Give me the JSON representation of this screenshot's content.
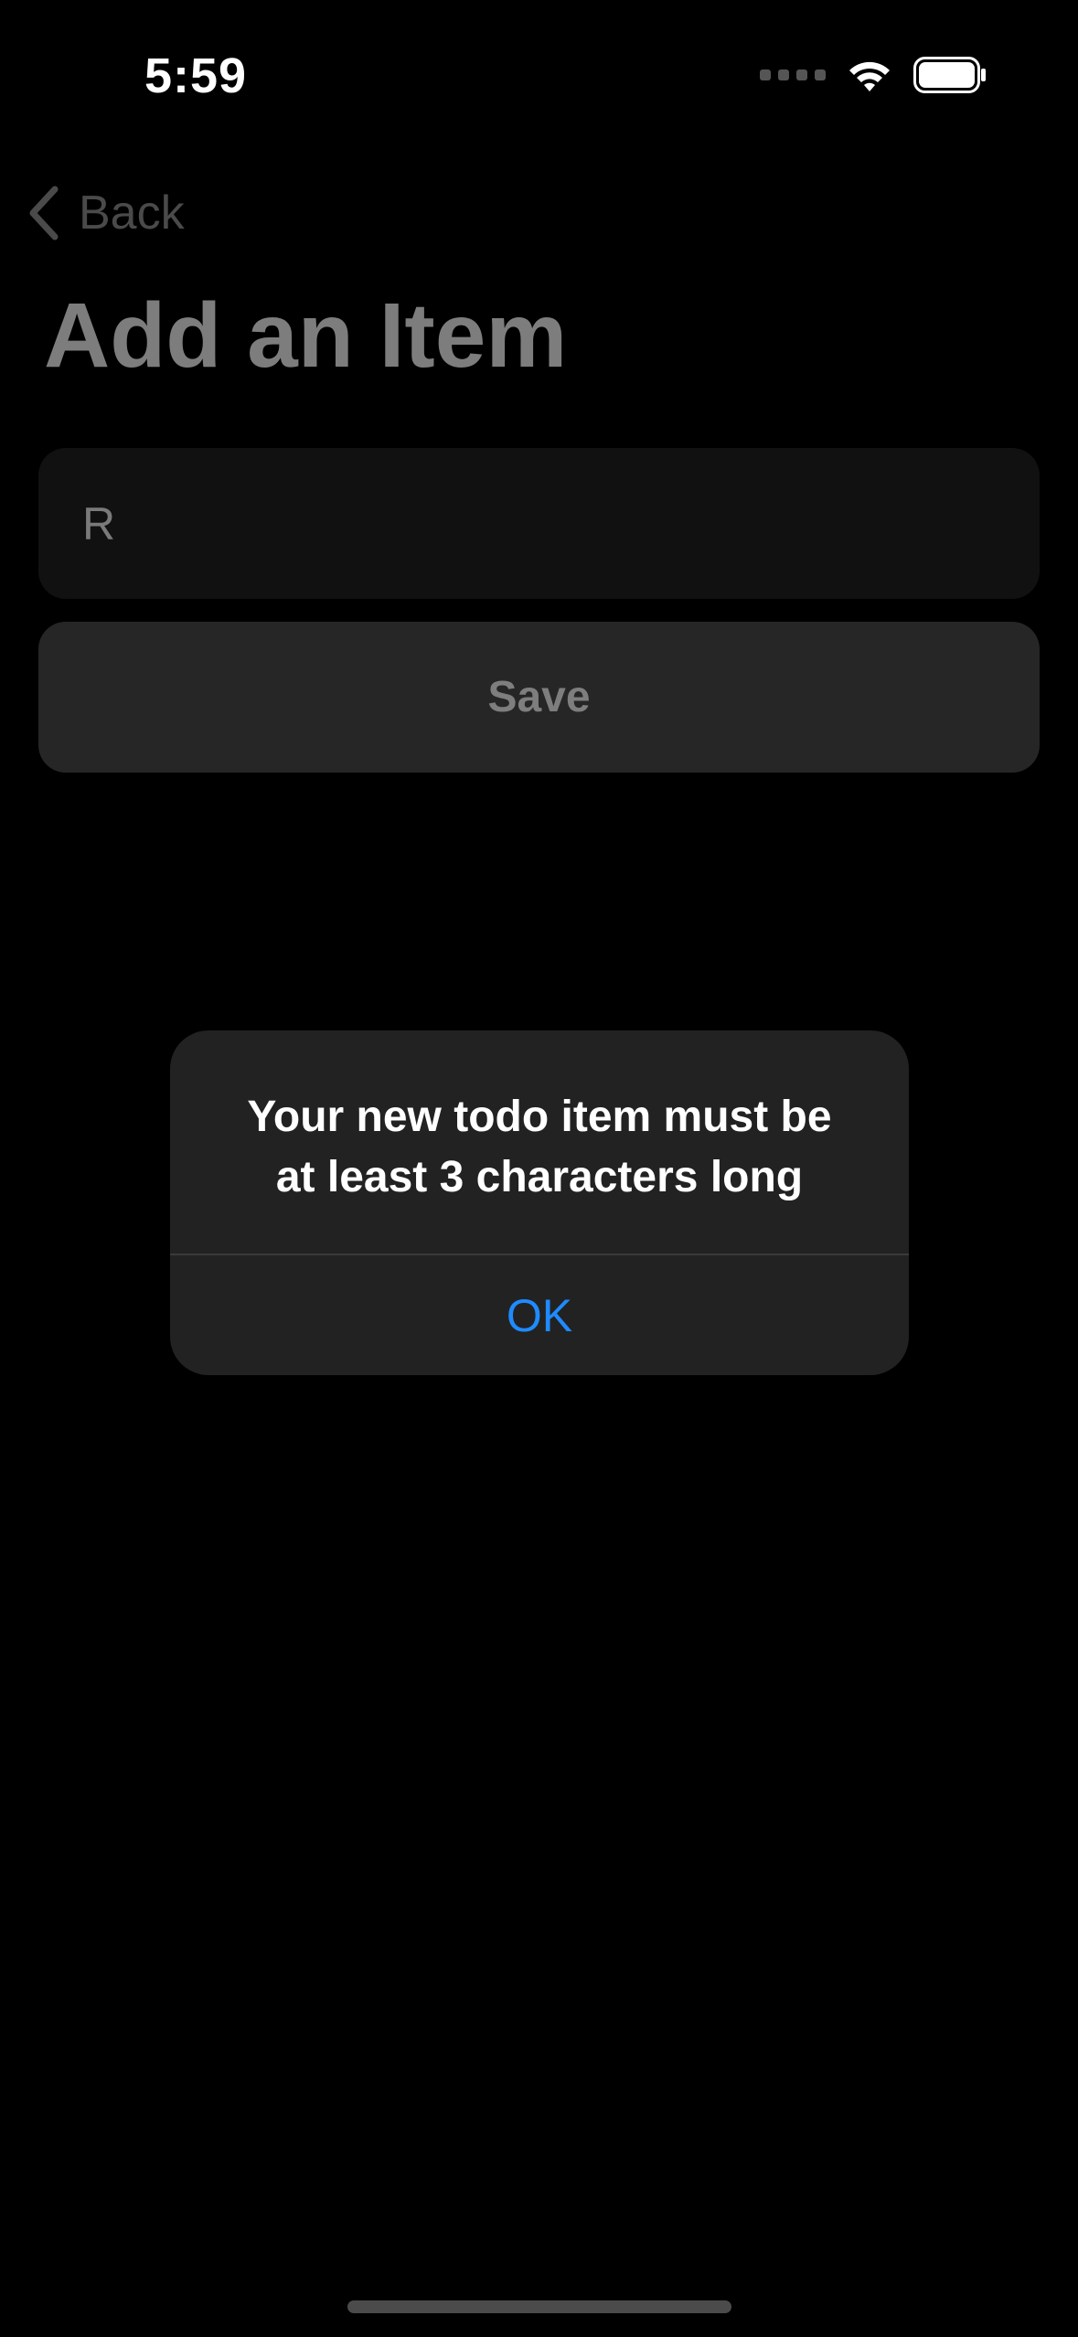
{
  "status_bar": {
    "time": "5:59",
    "icons": [
      "signal-dots-icon",
      "wifi-icon",
      "battery-icon"
    ]
  },
  "nav": {
    "back_label": "Back"
  },
  "page": {
    "title": "Add an Item"
  },
  "form": {
    "input_value": "R",
    "save_label": "Save"
  },
  "alert": {
    "message_line1": "Your new todo item must be",
    "message_line2": "at least 3 characters long",
    "ok_label": "OK",
    "accent_color": "#1e8bff"
  }
}
